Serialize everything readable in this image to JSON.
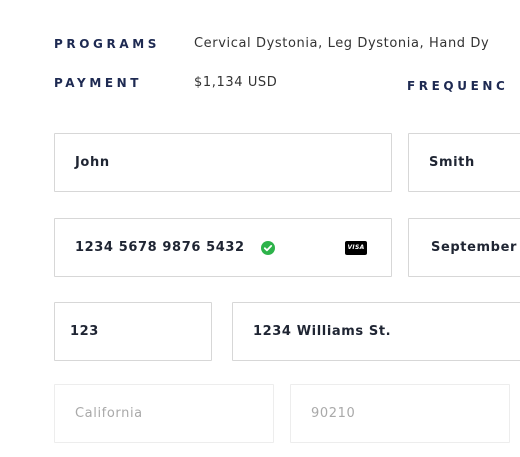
{
  "summary": {
    "programs_label": "PROGRAMS",
    "programs_value": "Cervical Dystonia, Leg Dystonia, Hand Dy",
    "payment_label": "PAYMENT",
    "payment_value": "$1,134 USD",
    "frequency_label": "FREQUENC"
  },
  "form": {
    "first_name": "John",
    "last_name": "Smith",
    "card_number": "1234 5678 9876 5432",
    "card_brand": "VISA",
    "expiry_month": "September",
    "street_number": "123",
    "street_name": "1234 Williams St.",
    "state": "California",
    "zip": "90210"
  },
  "colors": {
    "label": "#1e2a52",
    "valid": "#2db34a",
    "border": "#d7d7d7"
  }
}
